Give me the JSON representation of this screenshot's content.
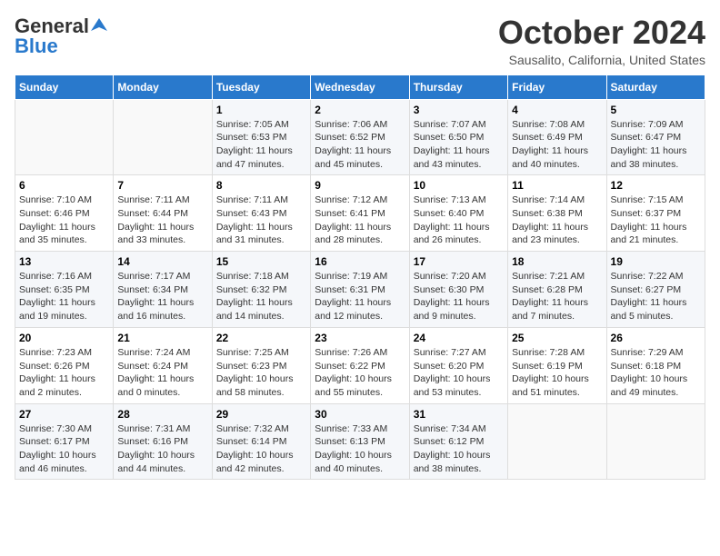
{
  "header": {
    "logo_line1": "General",
    "logo_line2": "Blue",
    "month": "October 2024",
    "location": "Sausalito, California, United States"
  },
  "weekdays": [
    "Sunday",
    "Monday",
    "Tuesday",
    "Wednesday",
    "Thursday",
    "Friday",
    "Saturday"
  ],
  "weeks": [
    [
      {
        "day": "",
        "content": ""
      },
      {
        "day": "",
        "content": ""
      },
      {
        "day": "1",
        "content": "Sunrise: 7:05 AM\nSunset: 6:53 PM\nDaylight: 11 hours and 47 minutes."
      },
      {
        "day": "2",
        "content": "Sunrise: 7:06 AM\nSunset: 6:52 PM\nDaylight: 11 hours and 45 minutes."
      },
      {
        "day": "3",
        "content": "Sunrise: 7:07 AM\nSunset: 6:50 PM\nDaylight: 11 hours and 43 minutes."
      },
      {
        "day": "4",
        "content": "Sunrise: 7:08 AM\nSunset: 6:49 PM\nDaylight: 11 hours and 40 minutes."
      },
      {
        "day": "5",
        "content": "Sunrise: 7:09 AM\nSunset: 6:47 PM\nDaylight: 11 hours and 38 minutes."
      }
    ],
    [
      {
        "day": "6",
        "content": "Sunrise: 7:10 AM\nSunset: 6:46 PM\nDaylight: 11 hours and 35 minutes."
      },
      {
        "day": "7",
        "content": "Sunrise: 7:11 AM\nSunset: 6:44 PM\nDaylight: 11 hours and 33 minutes."
      },
      {
        "day": "8",
        "content": "Sunrise: 7:11 AM\nSunset: 6:43 PM\nDaylight: 11 hours and 31 minutes."
      },
      {
        "day": "9",
        "content": "Sunrise: 7:12 AM\nSunset: 6:41 PM\nDaylight: 11 hours and 28 minutes."
      },
      {
        "day": "10",
        "content": "Sunrise: 7:13 AM\nSunset: 6:40 PM\nDaylight: 11 hours and 26 minutes."
      },
      {
        "day": "11",
        "content": "Sunrise: 7:14 AM\nSunset: 6:38 PM\nDaylight: 11 hours and 23 minutes."
      },
      {
        "day": "12",
        "content": "Sunrise: 7:15 AM\nSunset: 6:37 PM\nDaylight: 11 hours and 21 minutes."
      }
    ],
    [
      {
        "day": "13",
        "content": "Sunrise: 7:16 AM\nSunset: 6:35 PM\nDaylight: 11 hours and 19 minutes."
      },
      {
        "day": "14",
        "content": "Sunrise: 7:17 AM\nSunset: 6:34 PM\nDaylight: 11 hours and 16 minutes."
      },
      {
        "day": "15",
        "content": "Sunrise: 7:18 AM\nSunset: 6:32 PM\nDaylight: 11 hours and 14 minutes."
      },
      {
        "day": "16",
        "content": "Sunrise: 7:19 AM\nSunset: 6:31 PM\nDaylight: 11 hours and 12 minutes."
      },
      {
        "day": "17",
        "content": "Sunrise: 7:20 AM\nSunset: 6:30 PM\nDaylight: 11 hours and 9 minutes."
      },
      {
        "day": "18",
        "content": "Sunrise: 7:21 AM\nSunset: 6:28 PM\nDaylight: 11 hours and 7 minutes."
      },
      {
        "day": "19",
        "content": "Sunrise: 7:22 AM\nSunset: 6:27 PM\nDaylight: 11 hours and 5 minutes."
      }
    ],
    [
      {
        "day": "20",
        "content": "Sunrise: 7:23 AM\nSunset: 6:26 PM\nDaylight: 11 hours and 2 minutes."
      },
      {
        "day": "21",
        "content": "Sunrise: 7:24 AM\nSunset: 6:24 PM\nDaylight: 11 hours and 0 minutes."
      },
      {
        "day": "22",
        "content": "Sunrise: 7:25 AM\nSunset: 6:23 PM\nDaylight: 10 hours and 58 minutes."
      },
      {
        "day": "23",
        "content": "Sunrise: 7:26 AM\nSunset: 6:22 PM\nDaylight: 10 hours and 55 minutes."
      },
      {
        "day": "24",
        "content": "Sunrise: 7:27 AM\nSunset: 6:20 PM\nDaylight: 10 hours and 53 minutes."
      },
      {
        "day": "25",
        "content": "Sunrise: 7:28 AM\nSunset: 6:19 PM\nDaylight: 10 hours and 51 minutes."
      },
      {
        "day": "26",
        "content": "Sunrise: 7:29 AM\nSunset: 6:18 PM\nDaylight: 10 hours and 49 minutes."
      }
    ],
    [
      {
        "day": "27",
        "content": "Sunrise: 7:30 AM\nSunset: 6:17 PM\nDaylight: 10 hours and 46 minutes."
      },
      {
        "day": "28",
        "content": "Sunrise: 7:31 AM\nSunset: 6:16 PM\nDaylight: 10 hours and 44 minutes."
      },
      {
        "day": "29",
        "content": "Sunrise: 7:32 AM\nSunset: 6:14 PM\nDaylight: 10 hours and 42 minutes."
      },
      {
        "day": "30",
        "content": "Sunrise: 7:33 AM\nSunset: 6:13 PM\nDaylight: 10 hours and 40 minutes."
      },
      {
        "day": "31",
        "content": "Sunrise: 7:34 AM\nSunset: 6:12 PM\nDaylight: 10 hours and 38 minutes."
      },
      {
        "day": "",
        "content": ""
      },
      {
        "day": "",
        "content": ""
      }
    ]
  ]
}
